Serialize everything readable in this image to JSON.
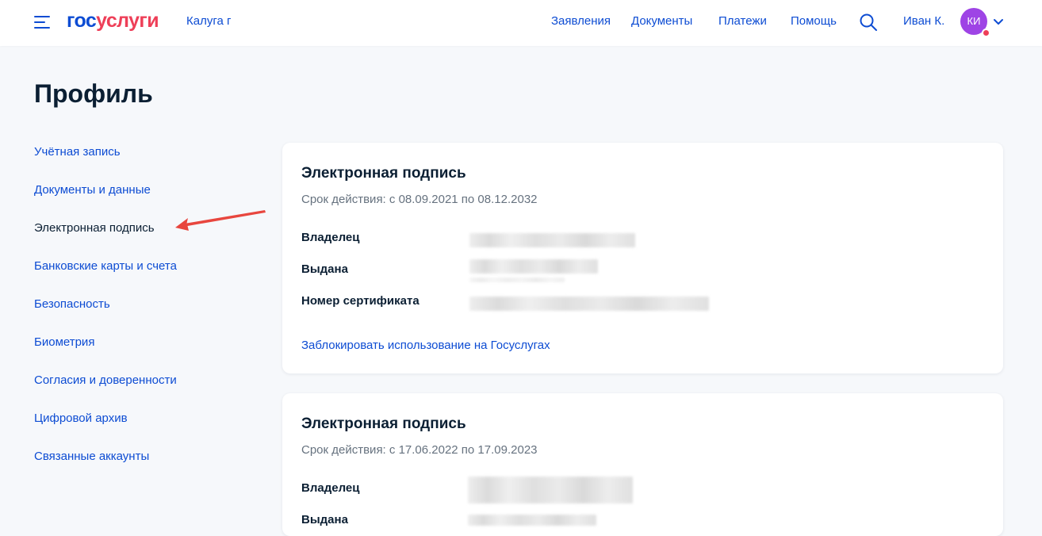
{
  "header": {
    "logo_part1": "гос",
    "logo_part2": "услуги",
    "region": "Калуга г",
    "nav": [
      "Заявления",
      "Документы",
      "Платежи",
      "Помощь"
    ],
    "user_name": "Иван К.",
    "avatar_initials": "КИ"
  },
  "page": {
    "title": "Профиль"
  },
  "sidebar": {
    "items": [
      "Учётная запись",
      "Документы и данные",
      "Электронная подпись",
      "Банковские карты и счета",
      "Безопасность",
      "Биометрия",
      "Согласия и доверенности",
      "Цифровой архив",
      "Связанные аккаунты"
    ],
    "active_item": "Электронная подпись"
  },
  "cards": [
    {
      "title": "Электронная подпись",
      "validity": "Срок действия: с 08.09.2021 по 08.12.2032",
      "fields": [
        "Владелец",
        "Выдана",
        "Номер сертификата"
      ],
      "action": "Заблокировать использование на Госуслугах"
    },
    {
      "title": "Электронная подпись",
      "validity": "Срок действия: с 17.06.2022 по 17.09.2023",
      "fields": [
        "Владелец",
        "Выдана"
      ]
    }
  ],
  "colors": {
    "brand_blue": "#0d4cd3",
    "brand_red": "#ee3f58",
    "avatar_bg": "#9e44e5",
    "annotation_arrow": "#e8463e"
  }
}
